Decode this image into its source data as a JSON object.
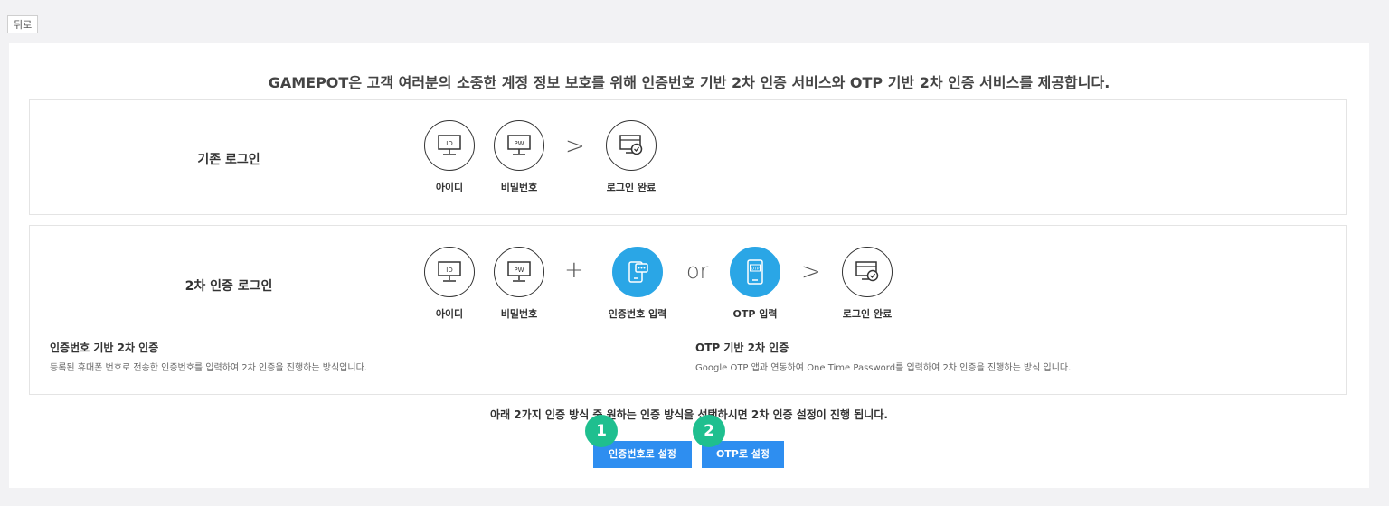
{
  "back_label": "뒤로",
  "headline": "GAMEPOT은 고객 여러분의 소중한 계정 정보 보호를 위해 인증번호 기반 2차 인증 서비스와 OTP 기반 2차 인증 서비스를 제공합니다.",
  "basic_login": {
    "title": "기존 로그인",
    "steps": [
      {
        "icon": "monitor-id-icon",
        "icon_text": "ID",
        "label": "아이디"
      },
      {
        "icon": "monitor-pw-icon",
        "icon_text": "PW",
        "label": "비밀번호"
      },
      {
        "icon": "login-complete-icon",
        "label": "로그인 완료"
      }
    ],
    "arrow": ">"
  },
  "two_factor_login": {
    "title": "2차 인증 로그인",
    "steps": [
      {
        "icon": "monitor-id-icon",
        "icon_text": "ID",
        "label": "아이디"
      },
      {
        "icon": "monitor-pw-icon",
        "icon_text": "PW",
        "label": "비밀번호"
      },
      {
        "icon": "phone-code-icon",
        "label": "인증번호 입력"
      },
      {
        "icon": "otp-device-icon",
        "icon_text": "OTP",
        "label": "OTP 입력"
      },
      {
        "icon": "login-complete-icon",
        "label": "로그인 완료"
      }
    ],
    "plus": "+",
    "or": "or",
    "arrow": ">"
  },
  "descriptions": {
    "code": {
      "title": "인증번호 기반 2차 인증",
      "text": "등록된 휴대폰 번호로 전송한 인증번호를 입력하여 2차 인증을 진행하는 방식입니다."
    },
    "otp": {
      "title": "OTP 기반 2차 인증",
      "text": "Google OTP 앱과 연동하여 One Time Password를 입력하여 2차 인증을 진행하는 방식 입니다."
    }
  },
  "bottom_text": "아래 2가지 인증 방식 중 원하는 인증 방식을 선택하시면 2차 인증 설정이 진행 됩니다.",
  "buttons": {
    "code_label": "인증번호로 설정",
    "otp_label": "OTP로 설정"
  },
  "badges": {
    "one": "1",
    "two": "2"
  },
  "colors": {
    "accent_blue": "#2aa6e6",
    "button_blue": "#2e8ef0",
    "badge_green": "#1fbf8f"
  }
}
